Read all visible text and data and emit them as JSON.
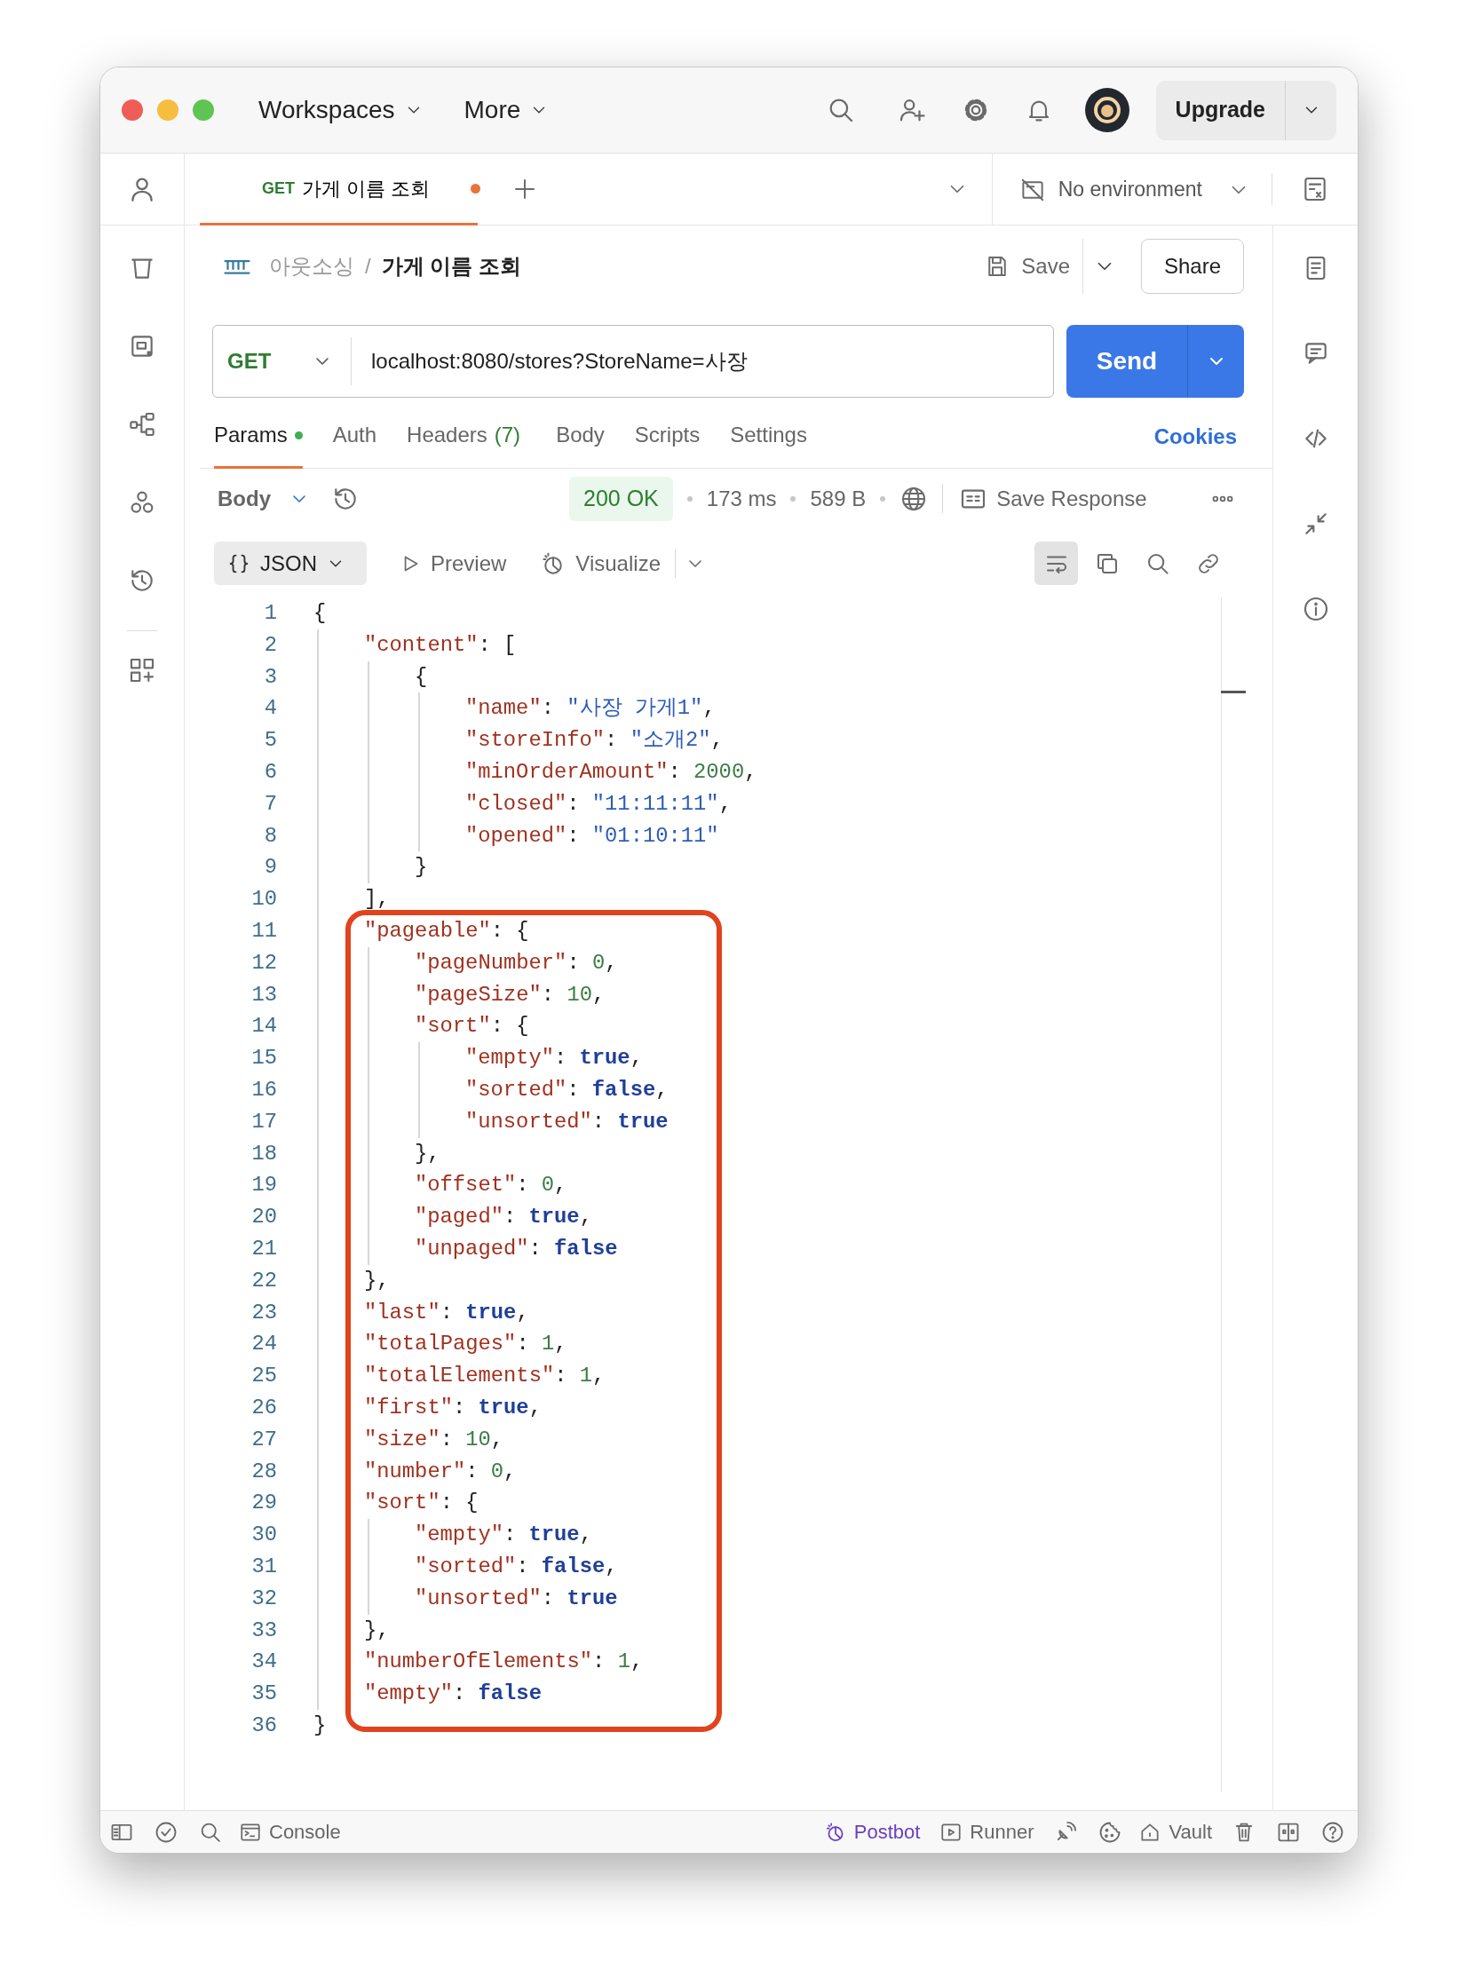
{
  "title_bar": {
    "menus": [
      {
        "label": "Workspaces"
      },
      {
        "label": "More"
      }
    ],
    "upgrade": "Upgrade"
  },
  "tabs": [
    {
      "method": "GET",
      "label": "가게 이름 조회",
      "selected": true,
      "unsaved": true
    }
  ],
  "environment": {
    "label": "No environment"
  },
  "breadcrumb": {
    "collection": "아웃소싱",
    "separator": "/",
    "request": "가게 이름 조회",
    "save": "Save",
    "share": "Share"
  },
  "request": {
    "method": "GET",
    "url": "localhost:8080/stores?StoreName=사장",
    "send": "Send"
  },
  "request_tabs": [
    {
      "label": "Params",
      "selected": true,
      "indicator": true
    },
    {
      "label": "Auth",
      "selected": false,
      "indicator": false
    },
    {
      "label": "Headers",
      "count": "(7)",
      "selected": false,
      "indicator": false
    },
    {
      "label": "Body",
      "selected": false,
      "indicator": false
    },
    {
      "label": "Scripts",
      "selected": false,
      "indicator": false
    },
    {
      "label": "Settings",
      "selected": false,
      "indicator": false
    }
  ],
  "cookies": "Cookies",
  "response": {
    "section": "Body",
    "status": "200 OK",
    "time": "173 ms",
    "size": "589 B",
    "save": "Save Response"
  },
  "view": {
    "format": "JSON",
    "preview": "Preview",
    "visualize": "Visualize",
    "tools": [
      {
        "kind": "wrap",
        "on": true
      },
      {
        "kind": "copy",
        "on": false
      },
      {
        "kind": "search",
        "on": false
      },
      {
        "kind": "link",
        "on": false
      }
    ]
  },
  "code": [
    {
      "line": "1",
      "tokens": [
        {
          "kind": "punct",
          "text": "{"
        }
      ],
      "children": [
        {
          "line": "2",
          "tokens": [
            {
              "kind": "key",
              "text": "\"content\""
            },
            {
              "kind": "punct",
              "text": ": ["
            }
          ],
          "children": [
            {
              "line": "3",
              "tokens": [
                {
                  "kind": "punct",
                  "text": "{"
                }
              ],
              "children": [
                {
                  "line": "4",
                  "tokens": [
                    {
                      "kind": "key",
                      "text": "\"name\""
                    },
                    {
                      "kind": "punct",
                      "text": ": "
                    },
                    {
                      "kind": "string",
                      "text": "\"사장 가게1\""
                    },
                    {
                      "kind": "punct",
                      "text": ","
                    }
                  ]
                },
                {
                  "line": "5",
                  "tokens": [
                    {
                      "kind": "key",
                      "text": "\"storeInfo\""
                    },
                    {
                      "kind": "punct",
                      "text": ": "
                    },
                    {
                      "kind": "string",
                      "text": "\"소개2\""
                    },
                    {
                      "kind": "punct",
                      "text": ","
                    }
                  ]
                },
                {
                  "line": "6",
                  "tokens": [
                    {
                      "kind": "key",
                      "text": "\"minOrderAmount\""
                    },
                    {
                      "kind": "punct",
                      "text": ": "
                    },
                    {
                      "kind": "number",
                      "text": "2000"
                    },
                    {
                      "kind": "punct",
                      "text": ","
                    }
                  ]
                },
                {
                  "line": "7",
                  "tokens": [
                    {
                      "kind": "key",
                      "text": "\"closed\""
                    },
                    {
                      "kind": "punct",
                      "text": ": "
                    },
                    {
                      "kind": "string",
                      "text": "\"11:11:11\""
                    },
                    {
                      "kind": "punct",
                      "text": ","
                    }
                  ]
                },
                {
                  "line": "8",
                  "tokens": [
                    {
                      "kind": "key",
                      "text": "\"opened\""
                    },
                    {
                      "kind": "punct",
                      "text": ": "
                    },
                    {
                      "kind": "string",
                      "text": "\"01:10:11\""
                    }
                  ]
                }
              ]
            },
            {
              "line": "9",
              "tokens": [
                {
                  "kind": "punct",
                  "text": "}"
                }
              ]
            }
          ]
        },
        {
          "line": "10",
          "tokens": [
            {
              "kind": "punct",
              "text": "],"
            }
          ]
        },
        {
          "line": "11",
          "tokens": [
            {
              "kind": "key",
              "text": "\"pageable\""
            },
            {
              "kind": "punct",
              "text": ": {"
            }
          ],
          "children": [
            {
              "line": "12",
              "tokens": [
                {
                  "kind": "key",
                  "text": "\"pageNumber\""
                },
                {
                  "kind": "punct",
                  "text": ": "
                },
                {
                  "kind": "number",
                  "text": "0"
                },
                {
                  "kind": "punct",
                  "text": ","
                }
              ]
            },
            {
              "line": "13",
              "tokens": [
                {
                  "kind": "key",
                  "text": "\"pageSize\""
                },
                {
                  "kind": "punct",
                  "text": ": "
                },
                {
                  "kind": "number",
                  "text": "10"
                },
                {
                  "kind": "punct",
                  "text": ","
                }
              ]
            },
            {
              "line": "14",
              "tokens": [
                {
                  "kind": "key",
                  "text": "\"sort\""
                },
                {
                  "kind": "punct",
                  "text": ": {"
                }
              ],
              "children": [
                {
                  "line": "15",
                  "tokens": [
                    {
                      "kind": "key",
                      "text": "\"empty\""
                    },
                    {
                      "kind": "punct",
                      "text": ": "
                    },
                    {
                      "kind": "bool",
                      "text": "true"
                    },
                    {
                      "kind": "punct",
                      "text": ","
                    }
                  ]
                },
                {
                  "line": "16",
                  "tokens": [
                    {
                      "kind": "key",
                      "text": "\"sorted\""
                    },
                    {
                      "kind": "punct",
                      "text": ": "
                    },
                    {
                      "kind": "bool",
                      "text": "false"
                    },
                    {
                      "kind": "punct",
                      "text": ","
                    }
                  ]
                },
                {
                  "line": "17",
                  "tokens": [
                    {
                      "kind": "key",
                      "text": "\"unsorted\""
                    },
                    {
                      "kind": "punct",
                      "text": ": "
                    },
                    {
                      "kind": "bool",
                      "text": "true"
                    }
                  ]
                }
              ]
            },
            {
              "line": "18",
              "tokens": [
                {
                  "kind": "punct",
                  "text": "},"
                }
              ]
            },
            {
              "line": "19",
              "tokens": [
                {
                  "kind": "key",
                  "text": "\"offset\""
                },
                {
                  "kind": "punct",
                  "text": ": "
                },
                {
                  "kind": "number",
                  "text": "0"
                },
                {
                  "kind": "punct",
                  "text": ","
                }
              ]
            },
            {
              "line": "20",
              "tokens": [
                {
                  "kind": "key",
                  "text": "\"paged\""
                },
                {
                  "kind": "punct",
                  "text": ": "
                },
                {
                  "kind": "bool",
                  "text": "true"
                },
                {
                  "kind": "punct",
                  "text": ","
                }
              ]
            },
            {
              "line": "21",
              "tokens": [
                {
                  "kind": "key",
                  "text": "\"unpaged\""
                },
                {
                  "kind": "punct",
                  "text": ": "
                },
                {
                  "kind": "bool",
                  "text": "false"
                }
              ]
            }
          ]
        },
        {
          "line": "22",
          "tokens": [
            {
              "kind": "punct",
              "text": "},"
            }
          ]
        },
        {
          "line": "23",
          "tokens": [
            {
              "kind": "key",
              "text": "\"last\""
            },
            {
              "kind": "punct",
              "text": ": "
            },
            {
              "kind": "bool",
              "text": "true"
            },
            {
              "kind": "punct",
              "text": ","
            }
          ]
        },
        {
          "line": "24",
          "tokens": [
            {
              "kind": "key",
              "text": "\"totalPages\""
            },
            {
              "kind": "punct",
              "text": ": "
            },
            {
              "kind": "number",
              "text": "1"
            },
            {
              "kind": "punct",
              "text": ","
            }
          ]
        },
        {
          "line": "25",
          "tokens": [
            {
              "kind": "key",
              "text": "\"totalElements\""
            },
            {
              "kind": "punct",
              "text": ": "
            },
            {
              "kind": "number",
              "text": "1"
            },
            {
              "kind": "punct",
              "text": ","
            }
          ]
        },
        {
          "line": "26",
          "tokens": [
            {
              "kind": "key",
              "text": "\"first\""
            },
            {
              "kind": "punct",
              "text": ": "
            },
            {
              "kind": "bool",
              "text": "true"
            },
            {
              "kind": "punct",
              "text": ","
            }
          ]
        },
        {
          "line": "27",
          "tokens": [
            {
              "kind": "key",
              "text": "\"size\""
            },
            {
              "kind": "punct",
              "text": ": "
            },
            {
              "kind": "number",
              "text": "10"
            },
            {
              "kind": "punct",
              "text": ","
            }
          ]
        },
        {
          "line": "28",
          "tokens": [
            {
              "kind": "key",
              "text": "\"number\""
            },
            {
              "kind": "punct",
              "text": ": "
            },
            {
              "kind": "number",
              "text": "0"
            },
            {
              "kind": "punct",
              "text": ","
            }
          ]
        },
        {
          "line": "29",
          "tokens": [
            {
              "kind": "key",
              "text": "\"sort\""
            },
            {
              "kind": "punct",
              "text": ": {"
            }
          ],
          "children": [
            {
              "line": "30",
              "tokens": [
                {
                  "kind": "key",
                  "text": "\"empty\""
                },
                {
                  "kind": "punct",
                  "text": ": "
                },
                {
                  "kind": "bool",
                  "text": "true"
                },
                {
                  "kind": "punct",
                  "text": ","
                }
              ]
            },
            {
              "line": "31",
              "tokens": [
                {
                  "kind": "key",
                  "text": "\"sorted\""
                },
                {
                  "kind": "punct",
                  "text": ": "
                },
                {
                  "kind": "bool",
                  "text": "false"
                },
                {
                  "kind": "punct",
                  "text": ","
                }
              ]
            },
            {
              "line": "32",
              "tokens": [
                {
                  "kind": "key",
                  "text": "\"unsorted\""
                },
                {
                  "kind": "punct",
                  "text": ": "
                },
                {
                  "kind": "bool",
                  "text": "true"
                }
              ]
            }
          ]
        },
        {
          "line": "33",
          "tokens": [
            {
              "kind": "punct",
              "text": "},"
            }
          ]
        },
        {
          "line": "34",
          "tokens": [
            {
              "kind": "key",
              "text": "\"numberOfElements\""
            },
            {
              "kind": "punct",
              "text": ": "
            },
            {
              "kind": "number",
              "text": "1"
            },
            {
              "kind": "punct",
              "text": ","
            }
          ]
        },
        {
          "line": "35",
          "tokens": [
            {
              "kind": "key",
              "text": "\"empty\""
            },
            {
              "kind": "punct",
              "text": ": "
            },
            {
              "kind": "bool",
              "text": "false"
            }
          ]
        }
      ]
    },
    {
      "line": "36",
      "tokens": [
        {
          "kind": "punct",
          "text": "}"
        }
      ]
    }
  ],
  "status_bar": [
    {
      "kind": "panel"
    },
    {
      "kind": "check"
    },
    {
      "kind": "search"
    },
    {
      "kind": "console",
      "label": "Console"
    },
    {
      "kind": "spacer"
    },
    {
      "kind": "postbot",
      "label": "Postbot"
    },
    {
      "kind": "runner",
      "label": "Runner"
    },
    {
      "kind": "satellite"
    },
    {
      "kind": "cookie"
    },
    {
      "kind": "vault",
      "label": "Vault"
    },
    {
      "kind": "trash"
    },
    {
      "kind": "layout"
    },
    {
      "kind": "help"
    }
  ]
}
